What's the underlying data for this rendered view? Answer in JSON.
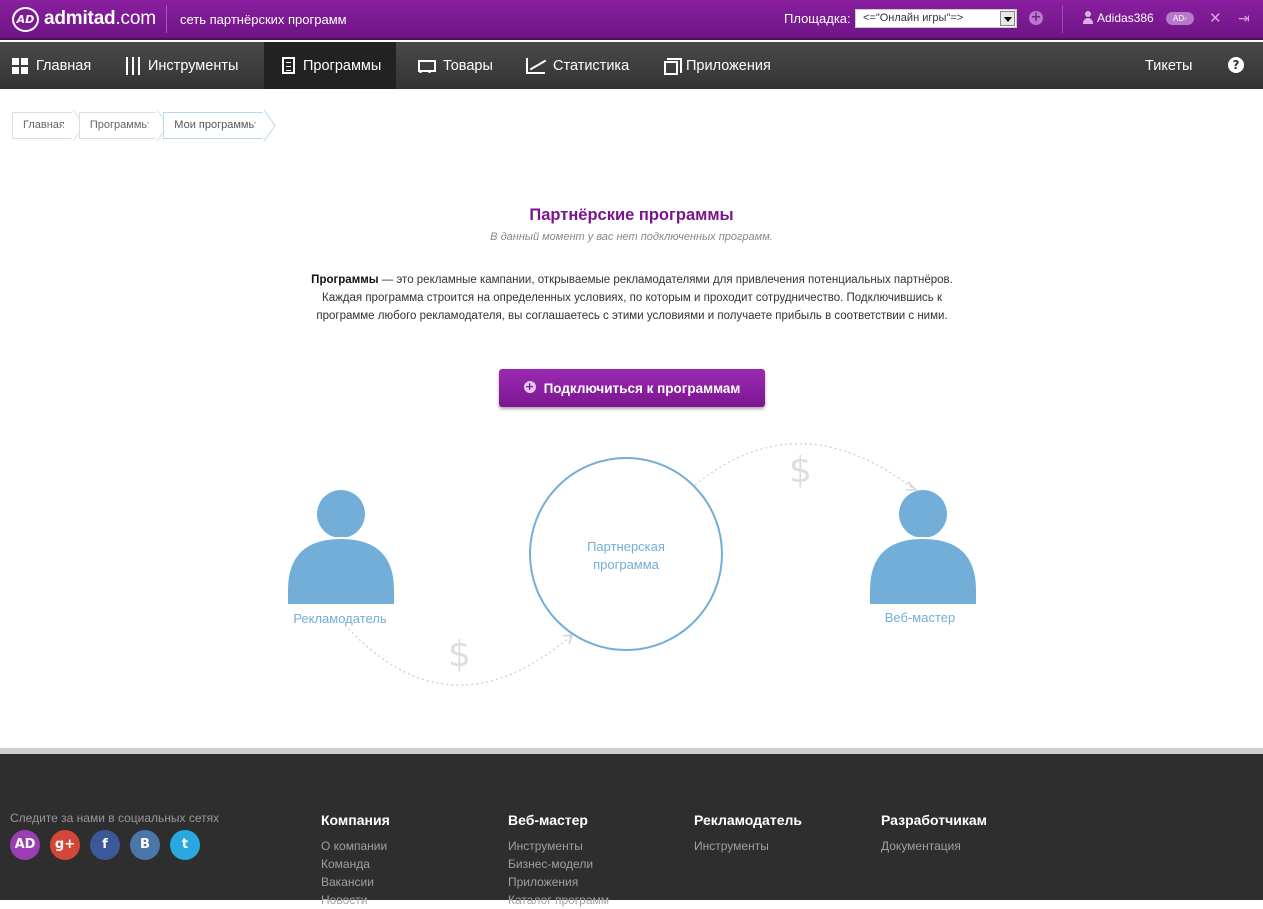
{
  "topbar": {
    "logo_badge": "AD",
    "logo_text_bold": "admit",
    "logo_text_mid": "ad",
    "logo_text_tail": ".com",
    "tagline": "сеть партнёрских программ",
    "platform_label": "Площадка:",
    "platform_value": "<=\"Онлайн игры\"=>",
    "username": "Adidas386",
    "user_badge": "AD◦"
  },
  "nav": {
    "items": [
      {
        "label": "Главная",
        "icon": "grid-icon"
      },
      {
        "label": "Инструменты",
        "icon": "tools-icon"
      },
      {
        "label": "Программы",
        "icon": "document-icon",
        "active": true
      },
      {
        "label": "Товары",
        "icon": "cart-icon"
      },
      {
        "label": "Статистика",
        "icon": "chart-icon"
      },
      {
        "label": "Приложения",
        "icon": "apps-icon"
      }
    ],
    "tickets": "Тикеты",
    "help": "?"
  },
  "breadcrumb": [
    "Главная",
    "Программы",
    "Мои программы"
  ],
  "main": {
    "title": "Партнёрские программы",
    "subtitle": "В данный момент у вас нет подключенных программ.",
    "desc_bold": "Программы",
    "desc_rest": " — это рекламные кампании, открываемые рекламодателями для привлечения потенциальных партнёров. Каждая программа строится на определенных условиях, по которым и проходит сотрудничество. Подключившись к программе любого рекламодателя, вы соглашаетесь с этими условиями и получаете прибыль в соответствии с ними.",
    "connect_button": "Подключиться к программам"
  },
  "diagram": {
    "advertiser": "Рекламодатель",
    "center_line1": "Партнерская",
    "center_line2": "программа",
    "webmaster": "Веб-мастер",
    "dollar": "$",
    "color": "#73aed8"
  },
  "footer": {
    "follow": "Следите за нами в социальных сетях",
    "socials": [
      {
        "name": "admitad",
        "glyph": "AD",
        "color": "#9b3db3"
      },
      {
        "name": "google-plus",
        "glyph": "g+",
        "color": "#d2473a"
      },
      {
        "name": "facebook",
        "glyph": "f",
        "color": "#3b5998"
      },
      {
        "name": "vkontakte",
        "glyph": "B",
        "color": "#4a76a8"
      },
      {
        "name": "twitter",
        "glyph": "t",
        "color": "#29a9df"
      }
    ],
    "columns": [
      {
        "title": "Компания",
        "links": [
          "О компании",
          "Команда",
          "Вакансии",
          "Новости"
        ]
      },
      {
        "title": "Веб-мастер",
        "links": [
          "Инструменты",
          "Бизнес-модели",
          "Приложения",
          "Каталог программ"
        ]
      },
      {
        "title": "Рекламодатель",
        "links": [
          "Инструменты"
        ]
      },
      {
        "title": "Разработчикам",
        "links": [
          "Документация"
        ]
      }
    ]
  }
}
